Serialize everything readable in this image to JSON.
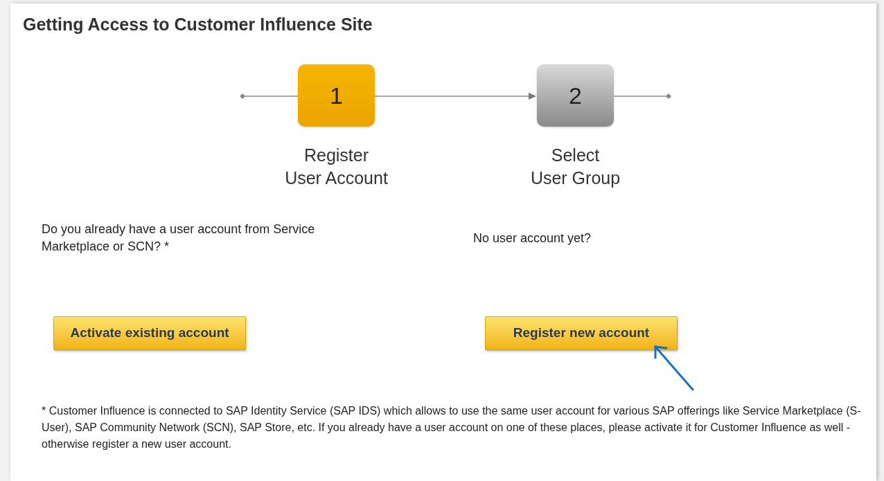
{
  "title": "Getting Access to Customer Influence Site",
  "steps": [
    {
      "number": "1",
      "label": [
        "Register",
        "User Account"
      ],
      "current": true
    },
    {
      "number": "2",
      "label": [
        "Select",
        "User Group"
      ],
      "current": false
    }
  ],
  "options": [
    {
      "question": "Do you already have a user account from Service Marketplace or SCN? *",
      "button": "Activate existing account"
    },
    {
      "question": "No user account yet?",
      "button": "Register new account"
    }
  ],
  "footnote": "* Customer Influence is connected to SAP Identity Service (SAP IDS) which allows to use the same user account for various SAP offerings like Service Marketplace (S-User), SAP Community Network (SCN), SAP Store, etc. If you already have a user account on one of these places, please activate it for Customer Influence as well - otherwise register a new user account."
}
